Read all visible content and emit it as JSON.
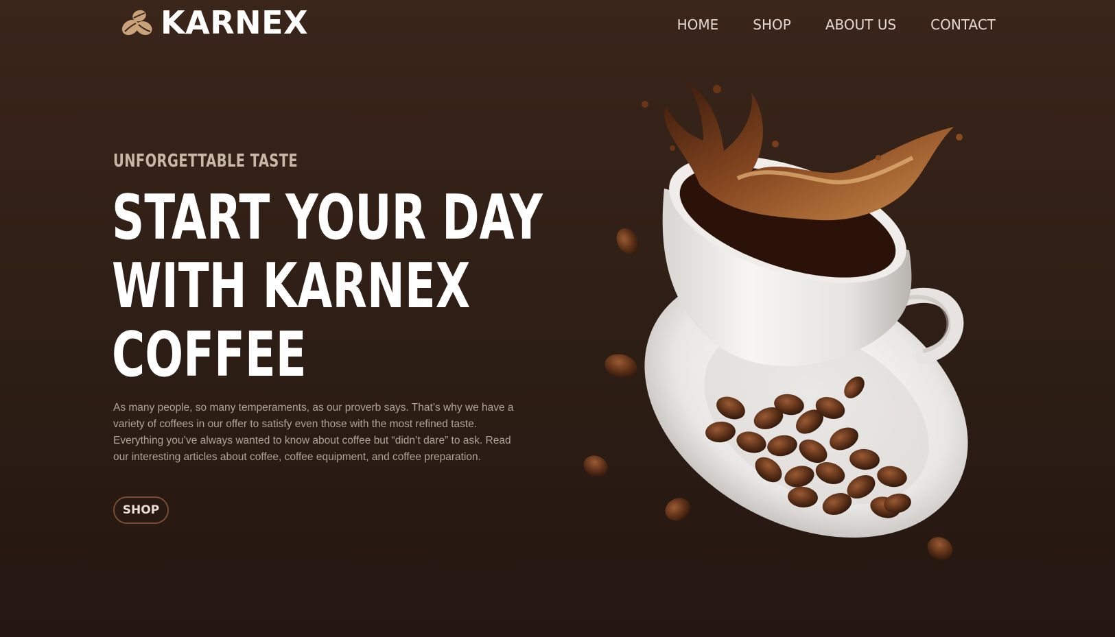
{
  "brand": {
    "name": "KARNEX",
    "icon": "coffee-beans-icon"
  },
  "nav": {
    "items": [
      {
        "label": "HOME"
      },
      {
        "label": "SHOP"
      },
      {
        "label": "ABOUT US"
      },
      {
        "label": "CONTACT"
      }
    ]
  },
  "hero": {
    "eyebrow": "UNFORGETTABLE TASTE",
    "headline_lines": [
      "START YOUR DAY",
      "WITH KARNEX",
      "COFFEE"
    ],
    "description": "As many people, so many temperaments, as our proverb says. That’s why we have a variety of coffees in our offer to satisfy even those with the most refined taste. Everything you’ve always wanted to know about coffee but “didn’t dare” to ask. Read our interesting articles about coffee, coffee equipment, and coffee preparation.",
    "cta_label": "SHOP",
    "image": "coffee-cup-splash-illustration"
  },
  "colors": {
    "background_top": "#3a251a",
    "background_bottom": "#241711",
    "button_border": "#7a4c36",
    "text_light": "#ffffff",
    "text_muted": "#b3a398"
  }
}
